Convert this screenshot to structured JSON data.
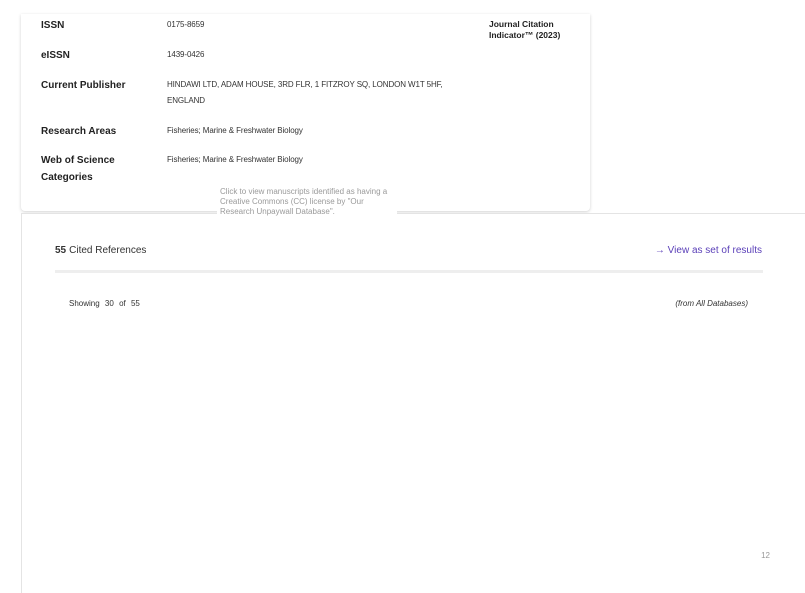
{
  "journal_info": {
    "rows": [
      {
        "label": "ISSN",
        "value": "0175-8659"
      },
      {
        "label": "eISSN",
        "value": "1439-0426"
      },
      {
        "label": "Current Publisher",
        "value": "HINDAWI LTD, ADAM HOUSE, 3RD FLR, 1 FITZROY SQ, LONDON W1T 5HF, ENGLAND"
      },
      {
        "label": "Research Areas",
        "value": "Fisheries; Marine & Freshwater Biology"
      },
      {
        "label": "Web of Science Categories",
        "value": "Fisheries; Marine & Freshwater Biology"
      }
    ],
    "jci_label": "Journal Citation Indicator™ (2023)"
  },
  "tooltip": {
    "text": "Click to view manuscripts identified as having a Creative Commons (CC) license by \"Our Research Unpaywall Database\"."
  },
  "cited_references": {
    "count": "55",
    "title": "Cited References",
    "view_link": "→ View as set of results",
    "showing_word": "Showing",
    "showing_current": "30",
    "showing_of": "of",
    "showing_total": "55",
    "source_note": "(from All Databases)"
  },
  "page_number": "12"
}
